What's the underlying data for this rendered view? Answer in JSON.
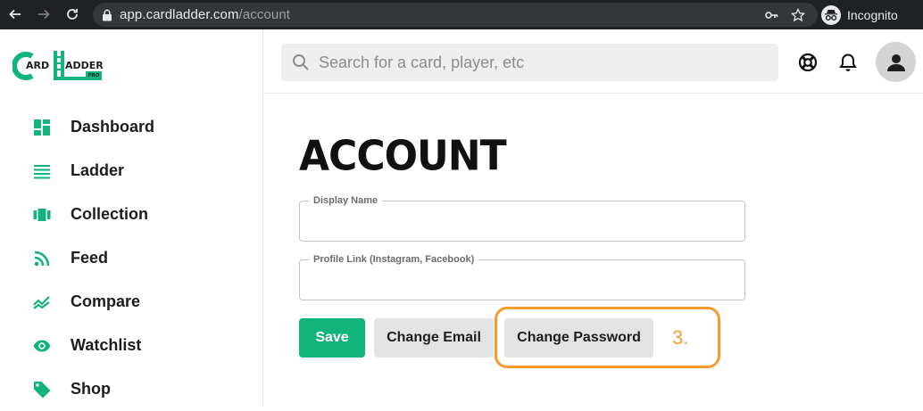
{
  "browser": {
    "url_host": "app.cardladder.com",
    "url_path": "/account",
    "incognito_label": "Incognito"
  },
  "logo": {
    "text_left": "ARD",
    "text_right": "ADDER",
    "badge": "PRO",
    "brand_color": "#12b47b"
  },
  "sidebar": {
    "items": [
      {
        "label": "Dashboard",
        "icon": "dashboard-icon"
      },
      {
        "label": "Ladder",
        "icon": "list-icon"
      },
      {
        "label": "Collection",
        "icon": "collection-icon"
      },
      {
        "label": "Feed",
        "icon": "rss-icon"
      },
      {
        "label": "Compare",
        "icon": "trend-icon"
      },
      {
        "label": "Watchlist",
        "icon": "eye-icon"
      },
      {
        "label": "Shop",
        "icon": "tag-icon"
      }
    ]
  },
  "header": {
    "search_placeholder": "Search for a card, player, etc"
  },
  "main": {
    "title": "ACCOUNT",
    "fields": [
      {
        "label": "Display Name",
        "value": ""
      },
      {
        "label": "Profile Link (Instagram, Facebook)",
        "value": ""
      }
    ],
    "buttons": {
      "save": "Save",
      "change_email": "Change Email",
      "change_password": "Change Password"
    },
    "annotation": "3.",
    "accent_color": "#12b47b",
    "annotation_color": "#f59a2c"
  }
}
